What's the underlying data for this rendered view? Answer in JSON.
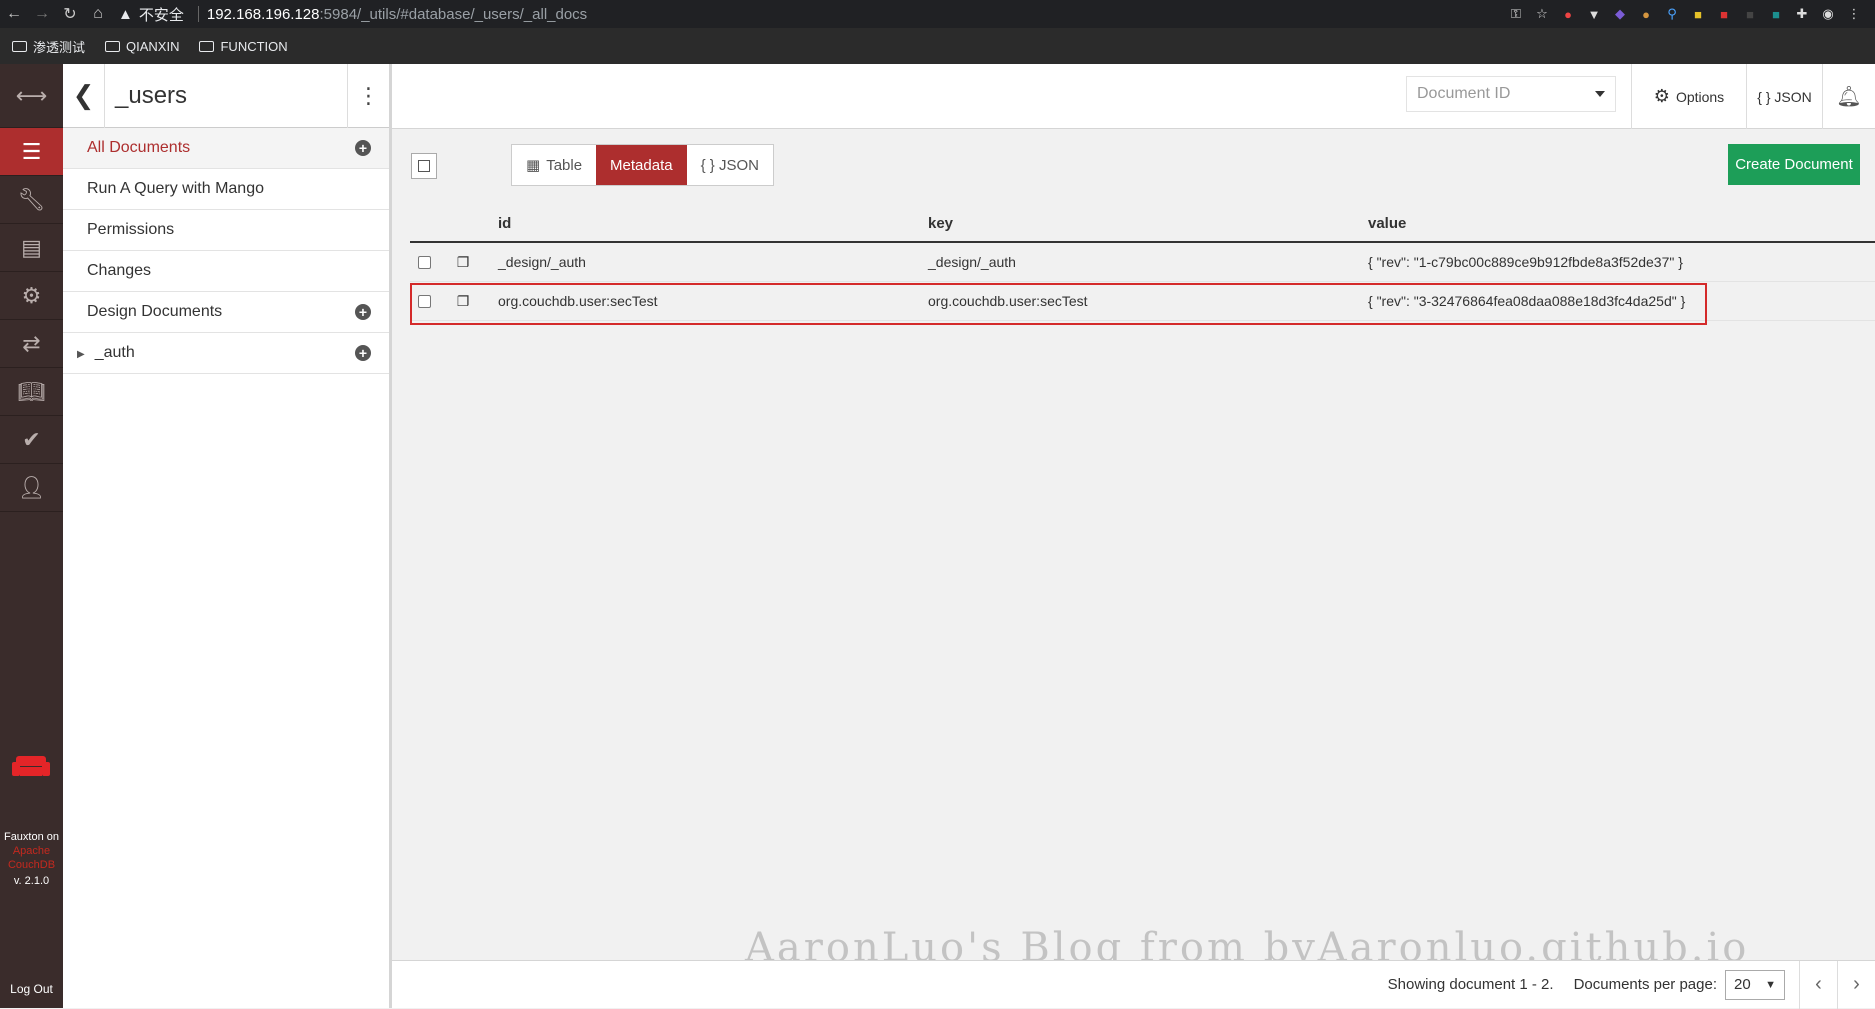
{
  "browser": {
    "insecure_label": "不安全",
    "url_host": "192.168.196.128",
    "url_path": ":5984/_utils/#database/_users/_all_docs",
    "bookmarks": [
      "渗透测试",
      "QIANXIN",
      "FUNCTION"
    ]
  },
  "leftnav": {
    "app_name": "Fauxton on",
    "apache": "Apache",
    "couchdb": "CouchDB",
    "version": "v. 2.1.0",
    "logout": "Log Out"
  },
  "sidebar": {
    "db_name": "_users",
    "items": [
      "All Documents",
      "Run A Query with Mango",
      "Permissions",
      "Changes",
      "Design Documents"
    ],
    "design_doc": "_auth"
  },
  "header": {
    "doc_id_placeholder": "Document ID",
    "options_label": "Options",
    "json_label": "{ } JSON"
  },
  "toolbar": {
    "tabs": [
      "Table",
      "Metadata",
      "{ } JSON"
    ],
    "active_tab": "Metadata",
    "create_label": "Create Document"
  },
  "table": {
    "columns": [
      "id",
      "key",
      "value"
    ],
    "rows": [
      {
        "id": "_design/_auth",
        "key": "_design/_auth",
        "value": "{ \"rev\": \"1-c79bc00c889ce9b912fbde8a3f52de37\" }"
      },
      {
        "id": "org.couchdb.user:secTest",
        "key": "org.couchdb.user:secTest",
        "value": "{ \"rev\": \"3-32476864fea08daa088e18d3fc4da25d\" }"
      }
    ]
  },
  "footer": {
    "showing": "Showing document 1 - 2.",
    "per_page_label": "Documents per page:",
    "per_page_value": "20"
  },
  "watermark": "AaronLuo's Blog from byAaronluo.github.io",
  "colors": {
    "accent": "#ad2e2e",
    "create": "#1d9e58",
    "nav_bg": "#3a2c2b",
    "highlight": "#d42a2a"
  }
}
